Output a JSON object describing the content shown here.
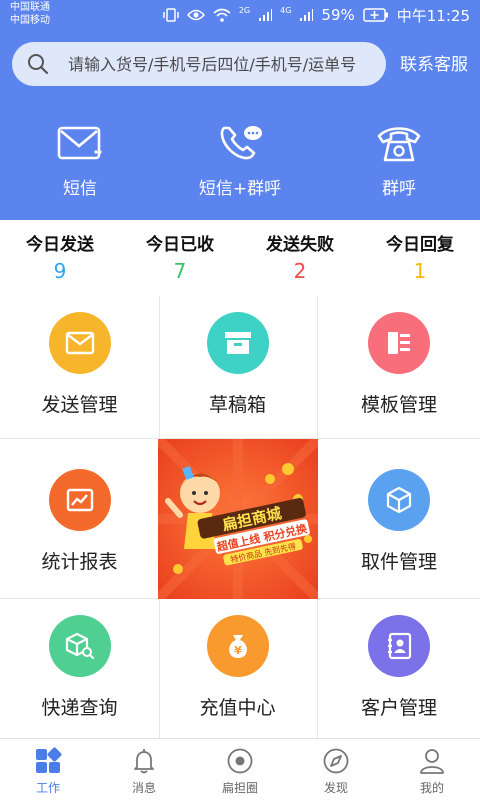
{
  "status_bar": {
    "carrier_1": "中国联通",
    "carrier_2": "中国移动",
    "network_1": "2G",
    "network_2": "4G",
    "battery": "59%",
    "time": "中午11:25"
  },
  "search": {
    "placeholder": "请输入货号/手机号后四位/手机号/运单号"
  },
  "header": {
    "service_label": "联系客服",
    "quick_actions": [
      {
        "label": "短信",
        "icon": "envelope-icon"
      },
      {
        "label": "短信+群呼",
        "icon": "phone-chat-icon"
      },
      {
        "label": "群呼",
        "icon": "telephone-icon"
      }
    ]
  },
  "stats": [
    {
      "label": "今日发送",
      "value": "9",
      "color": "#2fa8e8"
    },
    {
      "label": "今日已收",
      "value": "7",
      "color": "#35c46a"
    },
    {
      "label": "发送失败",
      "value": "2",
      "color": "#f04a4a"
    },
    {
      "label": "今日回复",
      "value": "1",
      "color": "#f5b800"
    }
  ],
  "grid": [
    {
      "label": "发送管理",
      "icon": "mail-icon",
      "color": "#f7b52c"
    },
    {
      "label": "草稿箱",
      "icon": "archive-box-icon",
      "color": "#3ed1c6"
    },
    {
      "label": "模板管理",
      "icon": "template-icon",
      "color": "#f86f7b"
    },
    {
      "label": "统计报表",
      "icon": "chart-icon",
      "color": "#f46a2c"
    },
    {
      "label": "取件管理",
      "icon": "package-icon",
      "color": "#5aa2f0"
    },
    {
      "label": "快递查询",
      "icon": "parcel-search-icon",
      "color": "#4fcf92"
    },
    {
      "label": "充值中心",
      "icon": "money-bag-icon",
      "color": "#f89a2e"
    },
    {
      "label": "客户管理",
      "icon": "contacts-icon",
      "color": "#7b71e8"
    }
  ],
  "promo": {
    "title": "扁担商城",
    "subtitle": "超值上线 积分兑换",
    "tagline": "特价商品 先到先得"
  },
  "tabbar": [
    {
      "label": "工作",
      "icon": "apps-grid-icon",
      "active": true
    },
    {
      "label": "消息",
      "icon": "bell-icon",
      "active": false
    },
    {
      "label": "扁担圈",
      "icon": "circle-dot-icon",
      "active": false
    },
    {
      "label": "发现",
      "icon": "compass-icon",
      "active": false
    },
    {
      "label": "我的",
      "icon": "person-icon",
      "active": false
    }
  ]
}
